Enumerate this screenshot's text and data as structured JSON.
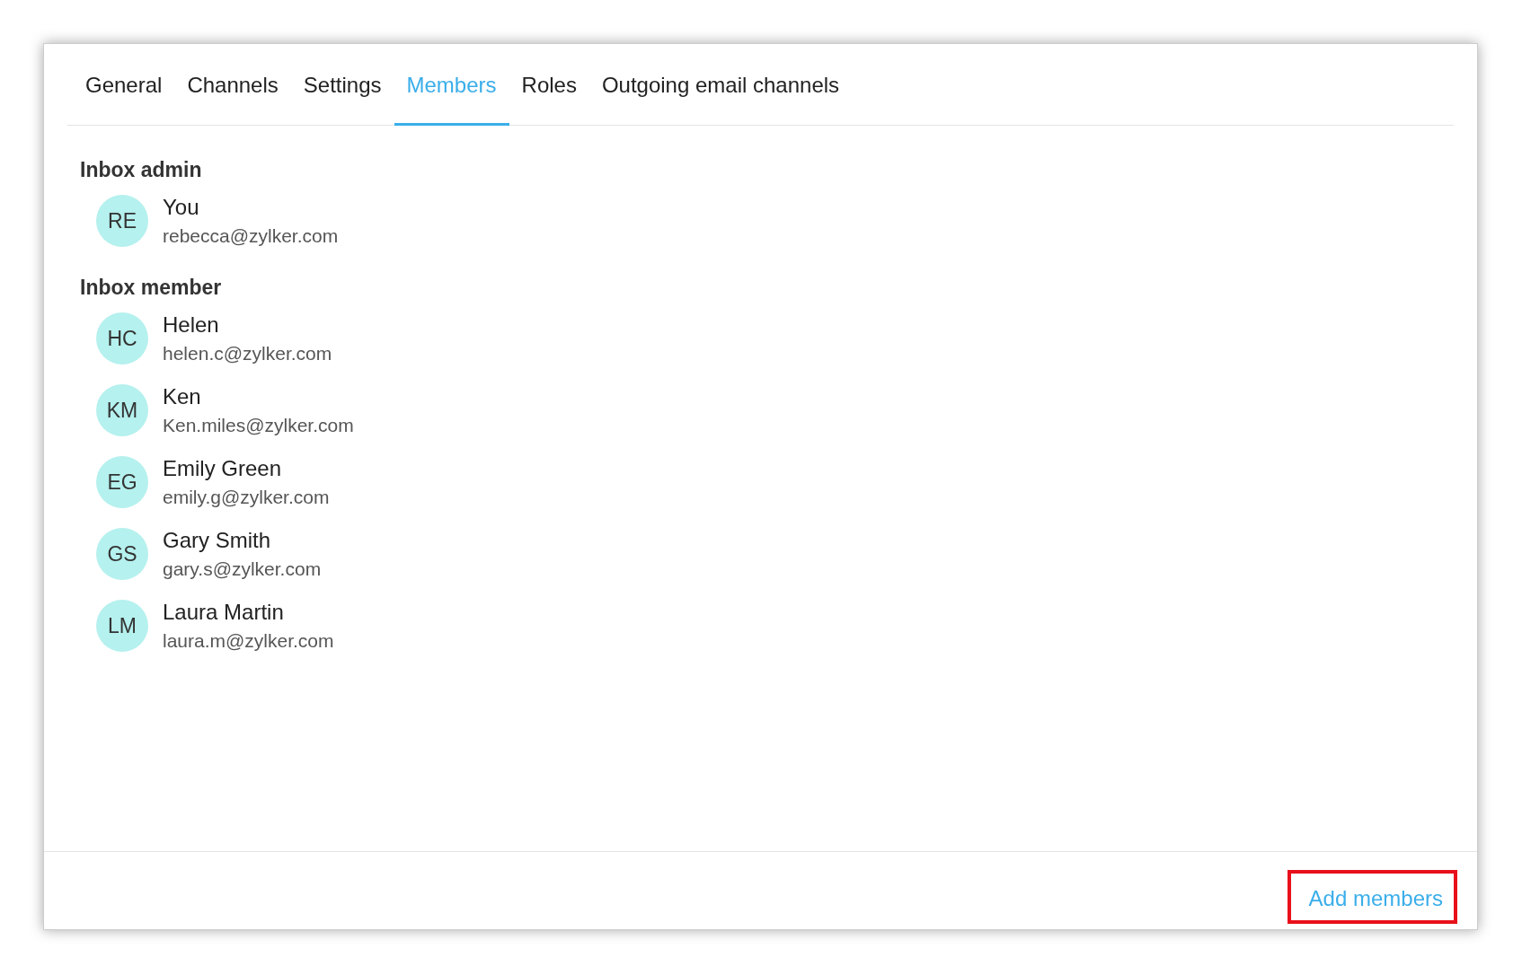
{
  "tabs": [
    {
      "label": "General",
      "selected": false
    },
    {
      "label": "Channels",
      "selected": false
    },
    {
      "label": "Settings",
      "selected": false
    },
    {
      "label": "Members",
      "selected": true
    },
    {
      "label": "Roles",
      "selected": false
    },
    {
      "label": "Outgoing email channels",
      "selected": false
    }
  ],
  "sections": [
    {
      "title": "Inbox admin",
      "members": [
        {
          "initials": "RE",
          "name": "You",
          "email": "rebecca@zylker.com"
        }
      ]
    },
    {
      "title": "Inbox member",
      "members": [
        {
          "initials": "HC",
          "name": "Helen",
          "email": "helen.c@zylker.com"
        },
        {
          "initials": "KM",
          "name": "Ken",
          "email": "Ken.miles@zylker.com"
        },
        {
          "initials": "EG",
          "name": "Emily Green",
          "email": "emily.g@zylker.com"
        },
        {
          "initials": "GS",
          "name": "Gary Smith",
          "email": "gary.s@zylker.com"
        },
        {
          "initials": "LM",
          "name": "Laura Martin",
          "email": "laura.m@zylker.com"
        }
      ]
    }
  ],
  "footer": {
    "button": {
      "label": "Add members",
      "highlighted": true
    }
  }
}
